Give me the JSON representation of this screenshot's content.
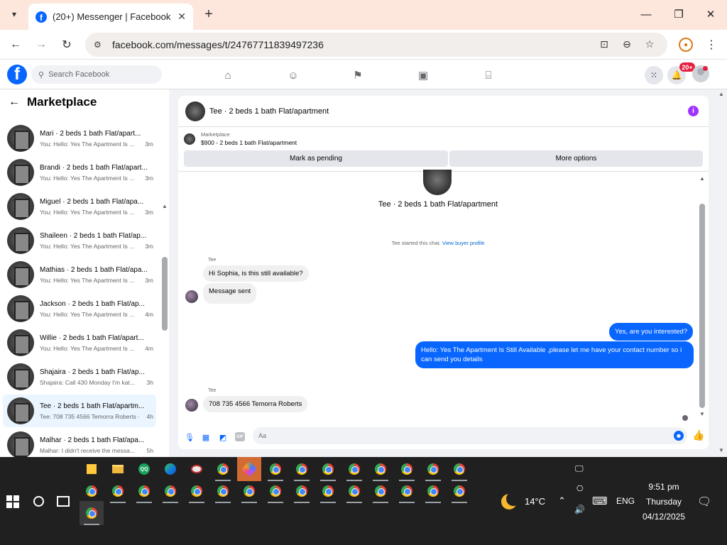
{
  "browser": {
    "tab_title": "(20+) Messenger | Facebook",
    "url": "facebook.com/messages/t/24767711839497236",
    "close_glyph": "✕",
    "newtab_glyph": "+",
    "minimize_glyph": "—",
    "maximize_glyph": "❐",
    "winclose_glyph": "✕"
  },
  "fb": {
    "search_placeholder": "Search Facebook",
    "notification_badge": "20+"
  },
  "sidebar": {
    "title": "Marketplace",
    "conversations": [
      {
        "name": "Mari · 2 beds 1 bath Flat/apart...",
        "preview": "You: Hello: Yes The Apartment Is ...",
        "time": "3m"
      },
      {
        "name": "Brandi · 2 beds 1 bath Flat/apart...",
        "preview": "You: Hello: Yes The Apartment Is ...",
        "time": "3m"
      },
      {
        "name": "Miguel · 2 beds 1 bath Flat/apa...",
        "preview": "You: Hello: Yes The Apartment Is ...",
        "time": "3m"
      },
      {
        "name": "Shaileen · 2 beds 1 bath Flat/ap...",
        "preview": "You: Hello: Yes The Apartment Is ...",
        "time": "3m"
      },
      {
        "name": "Mathias · 2 beds 1 bath Flat/apa...",
        "preview": "You: Hello: Yes The Apartment Is ...",
        "time": "3m"
      },
      {
        "name": "Jackson · 2 beds 1 bath Flat/ap...",
        "preview": "You: Hello: Yes The Apartment Is ...",
        "time": "4m"
      },
      {
        "name": "Willie · 2 beds 1 bath Flat/apart...",
        "preview": "You: Hello: Yes The Apartment Is ...",
        "time": "4m"
      },
      {
        "name": "Shajaira · 2 beds 1 bath Flat/ap...",
        "preview": "Shajaira: Call 430 Monday I'm kat...",
        "time": "3h"
      },
      {
        "name": "Tee · 2 beds 1 bath Flat/apartm...",
        "preview": "Tee: 708 735 4566 Temorra Roberts ·",
        "time": "4h"
      },
      {
        "name": "Malhar · 2 beds 1 bath Flat/apa...",
        "preview": "Malhar: I didn't receive the messa...",
        "time": "5h"
      }
    ]
  },
  "chat": {
    "header_name": "Tee · 2 beds 1 bath Flat/apartment",
    "marketplace_label": "Marketplace",
    "listing": "$900 - 2 beds 1 bath Flat/apartment",
    "mark_pending": "Mark as pending",
    "more_options": "More options",
    "big_name": "Tee · 2 beds 1 bath Flat/apartment",
    "system_text": "Tee started this chat.",
    "system_link": "View buyer profile",
    "sender_1": "Tee",
    "msg_1": "Hi Sophia, is this still available?",
    "msg_2": "Message sent",
    "out_1": "Yes, are you interested?",
    "out_2": "Hello: Yes The Apartment Is Still Available ,please let me have your contact number so i can send you details",
    "sender_2": "Tee",
    "msg_3": "708 735 4566 Temorra Roberts",
    "input_placeholder": "Aa"
  },
  "taskbar": {
    "weather": "14°C",
    "language": "ENG",
    "time": "9:51 pm",
    "day": "Thursday",
    "date": "04/12/2025"
  },
  "icons": [
    "chevron-down-icon",
    "facebook-icon",
    "close-icon",
    "plus-icon",
    "minimize-icon",
    "maximize-icon",
    "back-icon",
    "forward-icon",
    "reload-icon",
    "site-info-icon",
    "install-icon",
    "zoom-icon",
    "star-icon",
    "profile-icon",
    "kebab-icon",
    "search-icon",
    "home-icon",
    "friends-icon",
    "flag-icon",
    "video-icon",
    "store-icon",
    "grid-icon",
    "bell-icon",
    "info-icon",
    "mic-icon",
    "photo-icon",
    "sticker-icon",
    "gif-icon",
    "emoji-icon",
    "like-icon",
    "windows-start-icon",
    "cortana-icon",
    "task-view-icon",
    "chrome-icon",
    "moon-icon",
    "chevron-up-icon",
    "keyboard-icon",
    "notification-center-icon"
  ]
}
